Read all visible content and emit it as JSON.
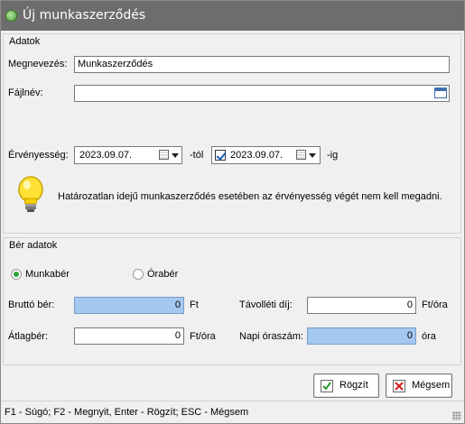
{
  "window": {
    "title": "Új munkaszerződés"
  },
  "adatok": {
    "group_title": "Adatok",
    "megnevezes_label": "Megnevezés:",
    "megnevezes_value": "Munkaszerződés",
    "fajlnev_label": "Fájlnév:",
    "fajlnev_value": "",
    "ervenyesseg_label": "Érvényesség:",
    "date_from": "2023.09.07.",
    "tol_label": "-tól",
    "date_to": "2023.09.07.",
    "date_to_checked": true,
    "ig_label": "-ig",
    "info_text": "Határozatlan idejű munkaszerződés esetében az érvényesség végét nem kell megadni."
  },
  "ber": {
    "group_title": "Bér adatok",
    "radio_monthly": "Munkabér",
    "radio_hourly": "Órabér",
    "selected": "Munkabér",
    "brutto_label": "Bruttó bér:",
    "brutto_value": "0",
    "brutto_unit": "Ft",
    "tavolleti_label": "Távolléti díj:",
    "tavolleti_value": "0",
    "tavolleti_unit": "Ft/óra",
    "atlag_label": "Átlagbér:",
    "atlag_value": "0",
    "atlag_unit": "Ft/óra",
    "napi_label": "Napi óraszám:",
    "napi_value": "0",
    "napi_unit": "óra"
  },
  "buttons": {
    "save": "Rögzít",
    "cancel": "Mégsem"
  },
  "status": {
    "text": "F1 - Súgó; F2 - Megnyit, Enter - Rögzít; ESC - Mégsem"
  },
  "colors": {
    "titlebar": "#6d6d6d",
    "readonly_field": "#a4c8f0",
    "radio_selected": "#2aa33a"
  }
}
